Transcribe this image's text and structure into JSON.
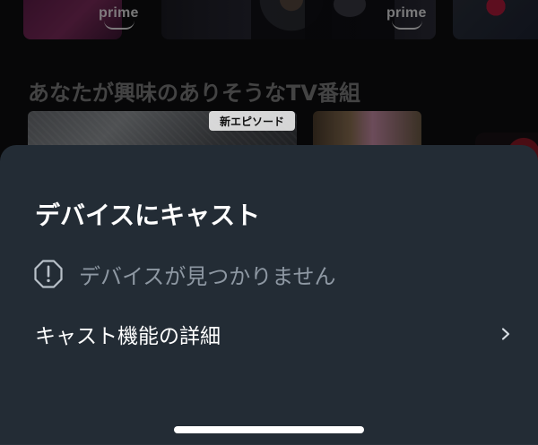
{
  "background": {
    "prime_label": "prime",
    "section_title": "あなたが興味のありそうなTV番組",
    "badge_new_episode": "新エピソード"
  },
  "sheet": {
    "title": "デバイスにキャスト",
    "status_text": "デバイスが見つかりません",
    "details_label": "キャスト機能の詳細",
    "icons": {
      "status": "alert-octagon-icon",
      "details": "chevron-right-icon"
    },
    "colors": {
      "sheet_bg": "#232c35",
      "muted_text": "#8e98a3",
      "primary_text": "#ffffff"
    }
  }
}
